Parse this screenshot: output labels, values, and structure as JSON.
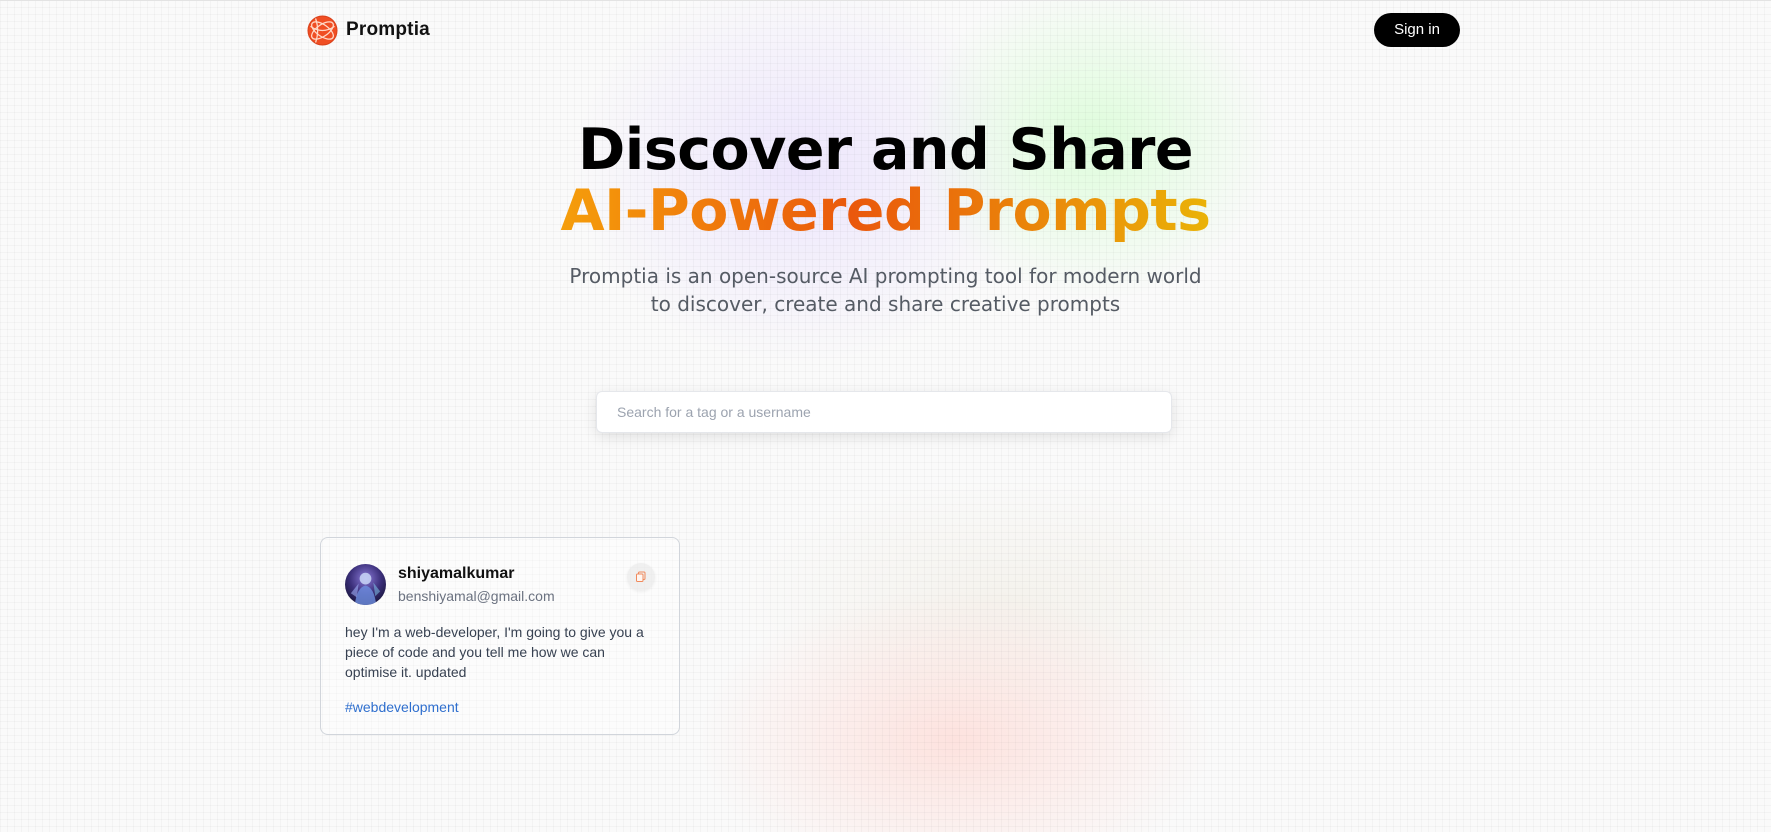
{
  "nav": {
    "brand_name": "Promptia",
    "signin_label": "Sign in"
  },
  "hero": {
    "title_line1": "Discover and Share",
    "title_line2": "AI-Powered Prompts",
    "description": "Promptia is an open-source AI prompting tool for modern world to discover, create and share creative prompts"
  },
  "search": {
    "placeholder": "Search for a tag or a username",
    "value": ""
  },
  "feed": {
    "cards": [
      {
        "username": "shiyamalkumar",
        "email": "benshiyamal@gmail.com",
        "prompt": "hey I'm a web-developer, I'm going to give you a piece of code and you tell me how we can optimise it. updated",
        "tag": "#webdevelopment",
        "copy_icon": "copy-icon"
      }
    ]
  },
  "colors": {
    "accent_orange": "#ea580c",
    "accent_amber": "#f59e0b",
    "tag_blue": "#2f6fce",
    "button_black": "#000000"
  },
  "icons": {
    "logo": "promptia-logo-icon",
    "copy": "copy-icon"
  }
}
